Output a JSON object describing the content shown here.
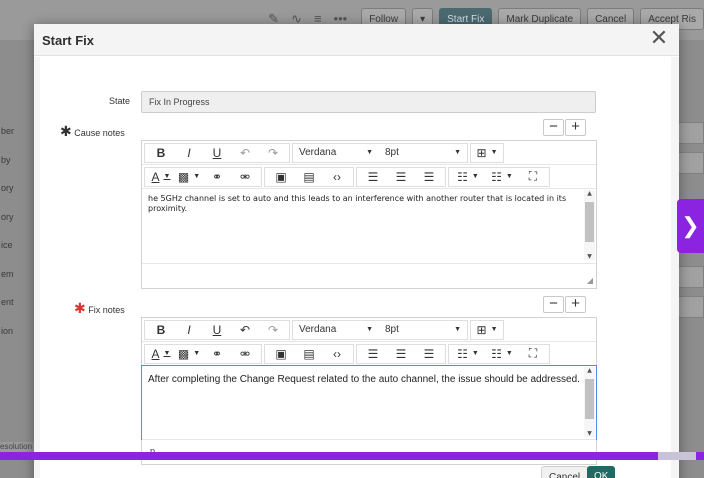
{
  "background": {
    "actions": [
      "Follow",
      "Start Fix",
      "Mark Duplicate",
      "Cancel",
      "Accept Ris"
    ],
    "left_labels": [
      "ber",
      "by",
      "ory",
      "ory",
      "ice",
      "em",
      "ent",
      "ion"
    ],
    "bottom_tab": "esolution"
  },
  "modal": {
    "title": "Start Fix",
    "close_icon": "close-icon",
    "state": {
      "label": "State",
      "value": "Fix In Progress"
    },
    "cause_notes": {
      "label": "Cause notes",
      "font": "Verdana",
      "size": "8pt",
      "content": "he 5GHz channel is set to auto and this leads to an interference with another router that is located in its proximity."
    },
    "fix_notes": {
      "label": "Fix notes",
      "font": "Verdana",
      "size": "8pt",
      "content": "After completing the Change Request related to the auto channel, the issue should be addressed.",
      "status_path": "p"
    },
    "footer": {
      "cancel": "Cancel",
      "ok": "OK"
    }
  },
  "colors": {
    "accent": "#8b24e0",
    "primary_button": "#1d6b63",
    "required": "#d33333"
  }
}
